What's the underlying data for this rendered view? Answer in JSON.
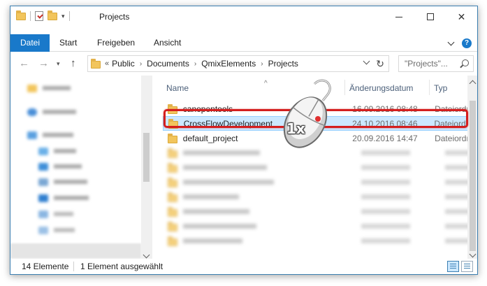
{
  "window": {
    "title": "Projects"
  },
  "ribbon": {
    "tabs": [
      "Datei",
      "Start",
      "Freigeben",
      "Ansicht"
    ],
    "help_label": "?"
  },
  "address": {
    "prefix": "«",
    "crumbs": [
      "Public",
      "Documents",
      "QmixElements",
      "Projects"
    ]
  },
  "search": {
    "placeholder": "\"Projects\"..."
  },
  "columns": {
    "name": "Name",
    "date": "Änderungsdatum",
    "type": "Typ"
  },
  "files": [
    {
      "name": "canopentools",
      "date": "16.09.2016 08:48",
      "type": "Dateiordner"
    },
    {
      "name": "CrossFlowDevelopment",
      "date": "24.10.2016 08:46",
      "type": "Dateiordner",
      "selected": true
    },
    {
      "name": "default_project",
      "date": "20.09.2016 14:47",
      "type": "Dateiordner"
    }
  ],
  "annotation": {
    "click_count": "1x"
  },
  "status": {
    "count": "14 Elemente",
    "selection": "1 Element ausgewählt"
  },
  "colors": {
    "accent": "#1979ca",
    "selection_bg": "#cce8ff",
    "highlight_frame": "#d41e1e",
    "folder": "#f2c55c"
  }
}
